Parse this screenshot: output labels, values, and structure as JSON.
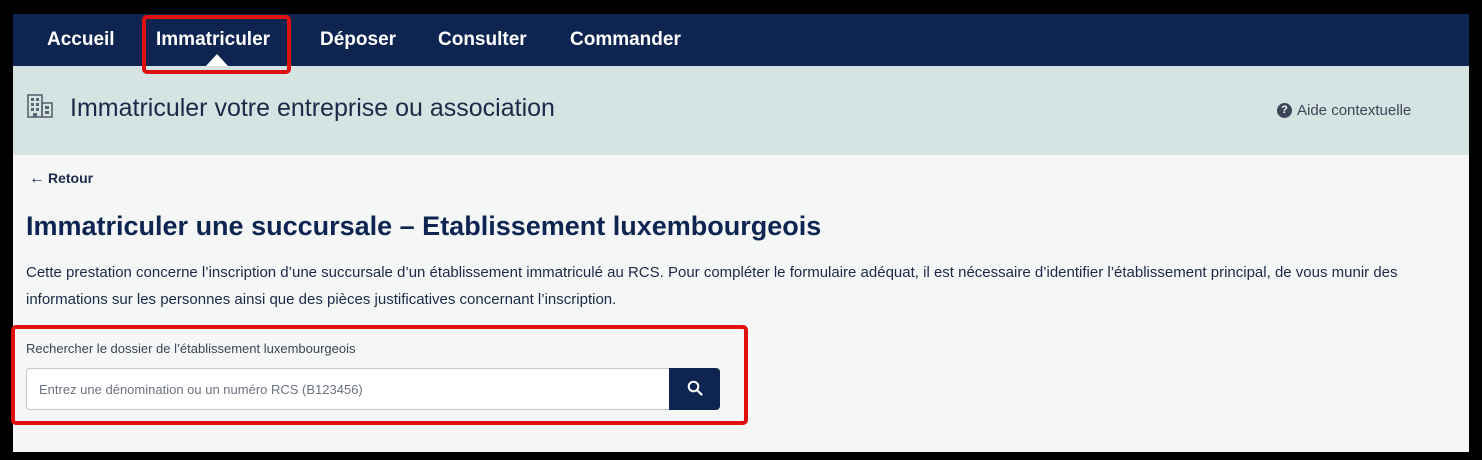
{
  "nav": {
    "items": [
      {
        "label": "Accueil"
      },
      {
        "label": "Immatriculer",
        "active": true
      },
      {
        "label": "Déposer"
      },
      {
        "label": "Consulter"
      },
      {
        "label": "Commander"
      }
    ]
  },
  "header": {
    "icon": "building-icon",
    "title": "Immatriculer votre entreprise ou association",
    "help_label": "Aide contextuelle",
    "help_icon": "question-circle-icon"
  },
  "back": {
    "label": "Retour",
    "icon": "arrow-left-icon"
  },
  "page": {
    "title": "Immatriculer une succursale – Etablissement luxembourgeois",
    "description": "Cette prestation concerne l’inscription d’une succursale d’un établissement immatriculé au RCS. Pour compléter le formulaire adéquat, il est nécessaire d’identifier l’établissement principal, de vous munir des informations sur les personnes ainsi que des pièces justificatives concernant l’inscription."
  },
  "search": {
    "label": "Rechercher le dossier de l’établissement luxembourgeois",
    "placeholder": "Entrez une dénomination ou un numéro RCS (B123456)",
    "value": "",
    "button_icon": "search-icon"
  },
  "colors": {
    "nav_bg": "#0d2550",
    "header_bg": "#d6e3e3",
    "page_bg": "#f5f6f6",
    "highlight": "#e01010"
  }
}
